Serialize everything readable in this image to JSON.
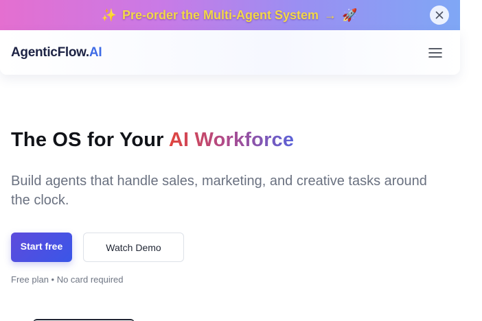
{
  "banner": {
    "sparkle_emoji": "✨",
    "text": "Pre-order the Multi-Agent System",
    "arrow": "→",
    "rocket_emoji": "🚀"
  },
  "header": {
    "logo_main": "AgenticFlow.",
    "logo_accent": "AI"
  },
  "hero": {
    "title_plain": "The OS for Your ",
    "title_gradient": "AI Workforce",
    "subtitle": "Build agents that handle sales, marketing, and creative tasks around the clock.",
    "primary_cta": "Start free",
    "secondary_cta": "Watch Demo",
    "note": "Free plan • No card required"
  },
  "icons": {
    "banner_close": "close-icon",
    "menu": "hamburger-menu-icon"
  },
  "colors": {
    "brand_navy": "#1d2344",
    "brand_blue": "#3f6be6",
    "gradient_start": "#e1453d",
    "gradient_end": "#5a62d8",
    "cta_start": "#5d4bdc",
    "cta_end": "#3a56e8"
  }
}
